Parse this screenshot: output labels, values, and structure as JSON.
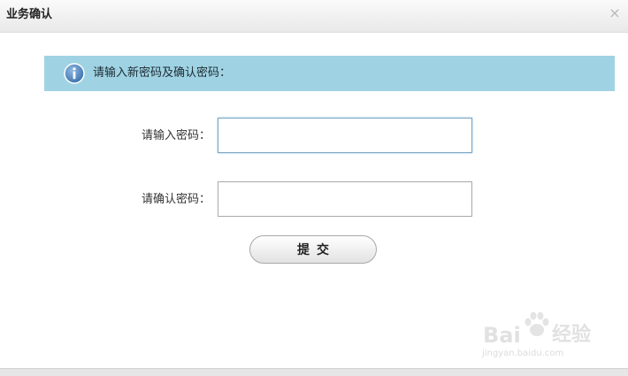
{
  "dialog": {
    "title": "业务确认",
    "close_symbol": "×"
  },
  "info": {
    "icon": "info-icon",
    "message": "请输入新密码及确认密码："
  },
  "form": {
    "password_label": "请输入密码：",
    "password_value": "",
    "confirm_label": "请确认密码：",
    "confirm_value": "",
    "submit_label": "提交"
  },
  "watermark": {
    "brand": "Bai",
    "brand_cn": "经验",
    "url": "jingyan.baidu.com"
  },
  "colors": {
    "banner_bg": "#9fd3e3",
    "info_icon": "#4a80b8"
  }
}
